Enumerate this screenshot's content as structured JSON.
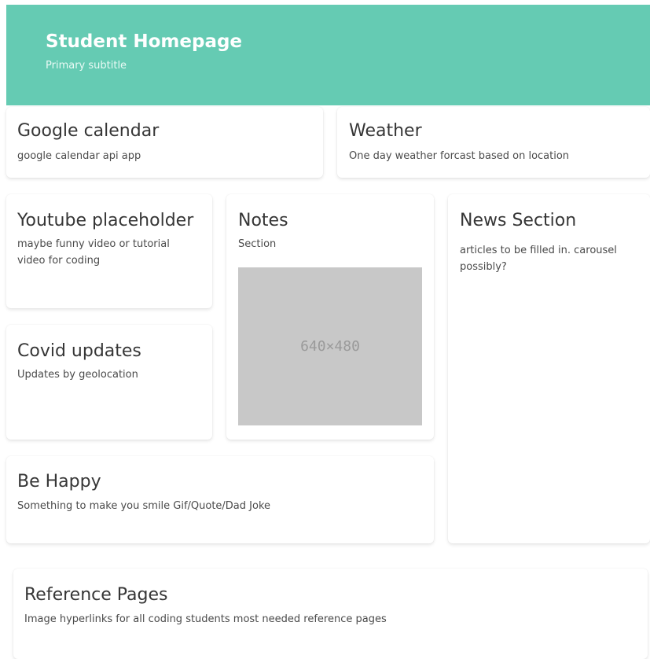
{
  "hero": {
    "title": "Student Homepage",
    "subtitle": "Primary subtitle",
    "background": "#65cbb3"
  },
  "cards": {
    "calendar": {
      "title": "Google calendar",
      "subtitle": "google calendar api app"
    },
    "weather": {
      "title": "Weather",
      "subtitle": "One day weather forcast based on location"
    },
    "youtube": {
      "title": "Youtube placeholder",
      "subtitle": "maybe funny video or tutorial video for coding"
    },
    "notes": {
      "title": "Notes",
      "subtitle": "Section",
      "image_placeholder": "640×480"
    },
    "news": {
      "title": "News Section",
      "subtitle": "articles to be filled in. carousel possibly?"
    },
    "covid": {
      "title": "Covid updates",
      "subtitle": "Updates by geolocation"
    },
    "happy": {
      "title": "Be Happy",
      "subtitle": "Something to make you smile Gif/Quote/Dad Joke"
    },
    "reference": {
      "title": "Reference Pages",
      "subtitle": "Image hyperlinks for all coding students most needed reference pages"
    }
  }
}
